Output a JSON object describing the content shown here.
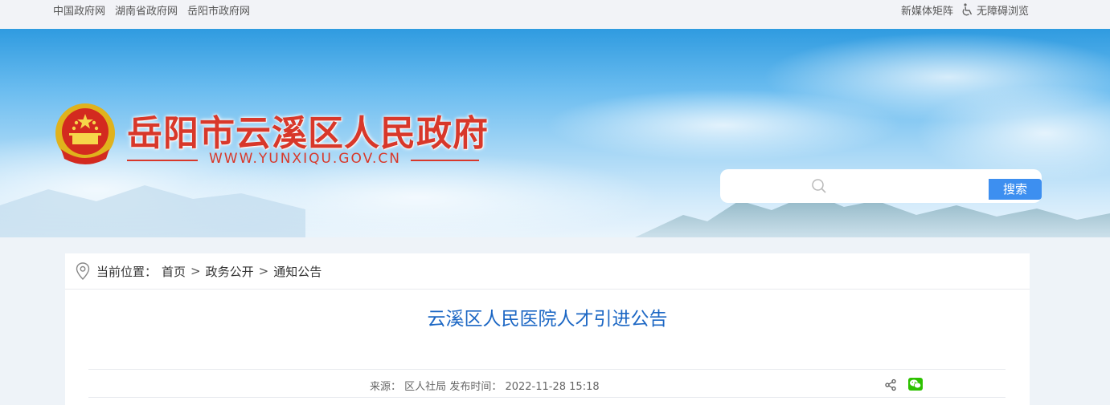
{
  "topbar": {
    "links": [
      "中国政府网",
      "湖南省政府网",
      "岳阳市政府网"
    ],
    "media_matrix": "新媒体矩阵",
    "accessibility": "无障碍浏览",
    "accessibility_icon": "wheelchair-icon"
  },
  "header": {
    "site_title": "岳阳市云溪区人民政府",
    "site_url": "WWW.YUNXIQU.GOV.CN",
    "emblem_icon": "national-emblem-icon",
    "title_color": "#d8382a"
  },
  "search": {
    "placeholder": "",
    "value": "",
    "button_label": "搜索",
    "search_icon": "search-icon",
    "button_color": "#3d8ff0"
  },
  "breadcrumb": {
    "label": "当前位置：",
    "items": [
      "首页",
      "政务公开",
      "通知公告"
    ],
    "separator": ">",
    "icon": "location-pin-icon"
  },
  "article": {
    "title": "云溪区人民医院人才引进公告",
    "title_color": "#1c67c4",
    "source_label": "来源：",
    "source": "区人社局",
    "publish_label": "发布时间：",
    "publish_time": "2022-11-28 15:18",
    "share_icon": "share-icon",
    "wechat_icon": "wechat-icon"
  }
}
